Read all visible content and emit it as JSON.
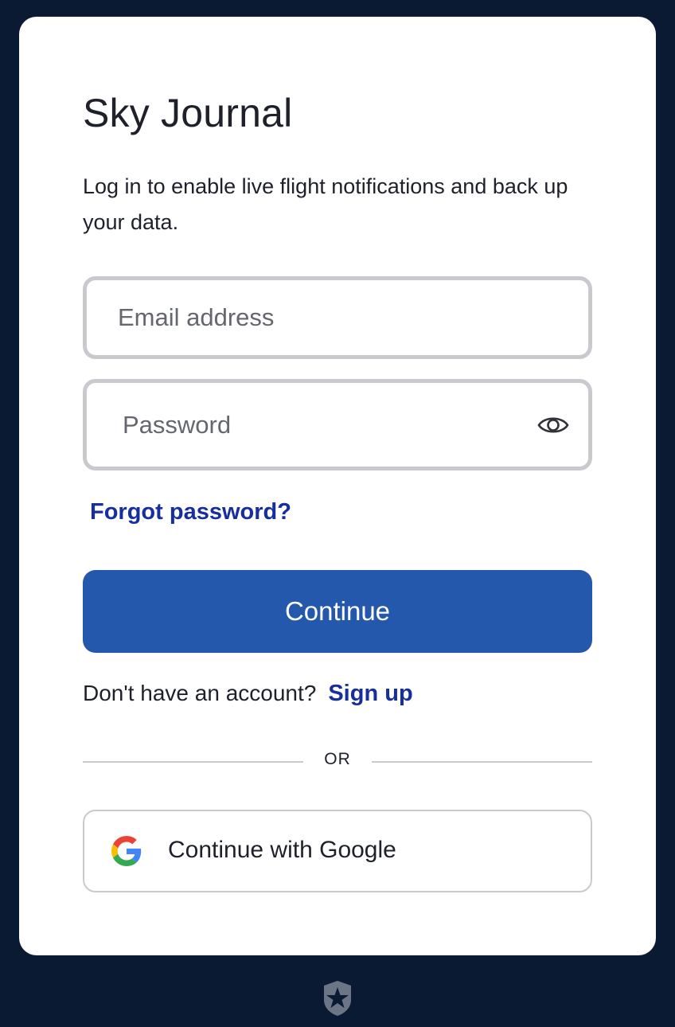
{
  "app": {
    "title": "Sky Journal",
    "subtitle": "Log in to enable live flight notifications and back up your data."
  },
  "form": {
    "email_placeholder": "Email address",
    "email_value": "",
    "password_placeholder": "Password",
    "password_value": "",
    "forgot_label": "Forgot password?",
    "continue_label": "Continue",
    "signup_prompt": "Don't have an account?",
    "signup_label": "Sign up",
    "divider_label": "OR",
    "google_label": "Continue with Google"
  },
  "icons": {
    "password_toggle": "eye-icon",
    "google": "google-logo-icon",
    "footer": "auth-shield-star-icon"
  },
  "colors": {
    "background": "#0b1a33",
    "primary": "#2358ac",
    "link": "#172e9e",
    "border": "#c9cace"
  }
}
